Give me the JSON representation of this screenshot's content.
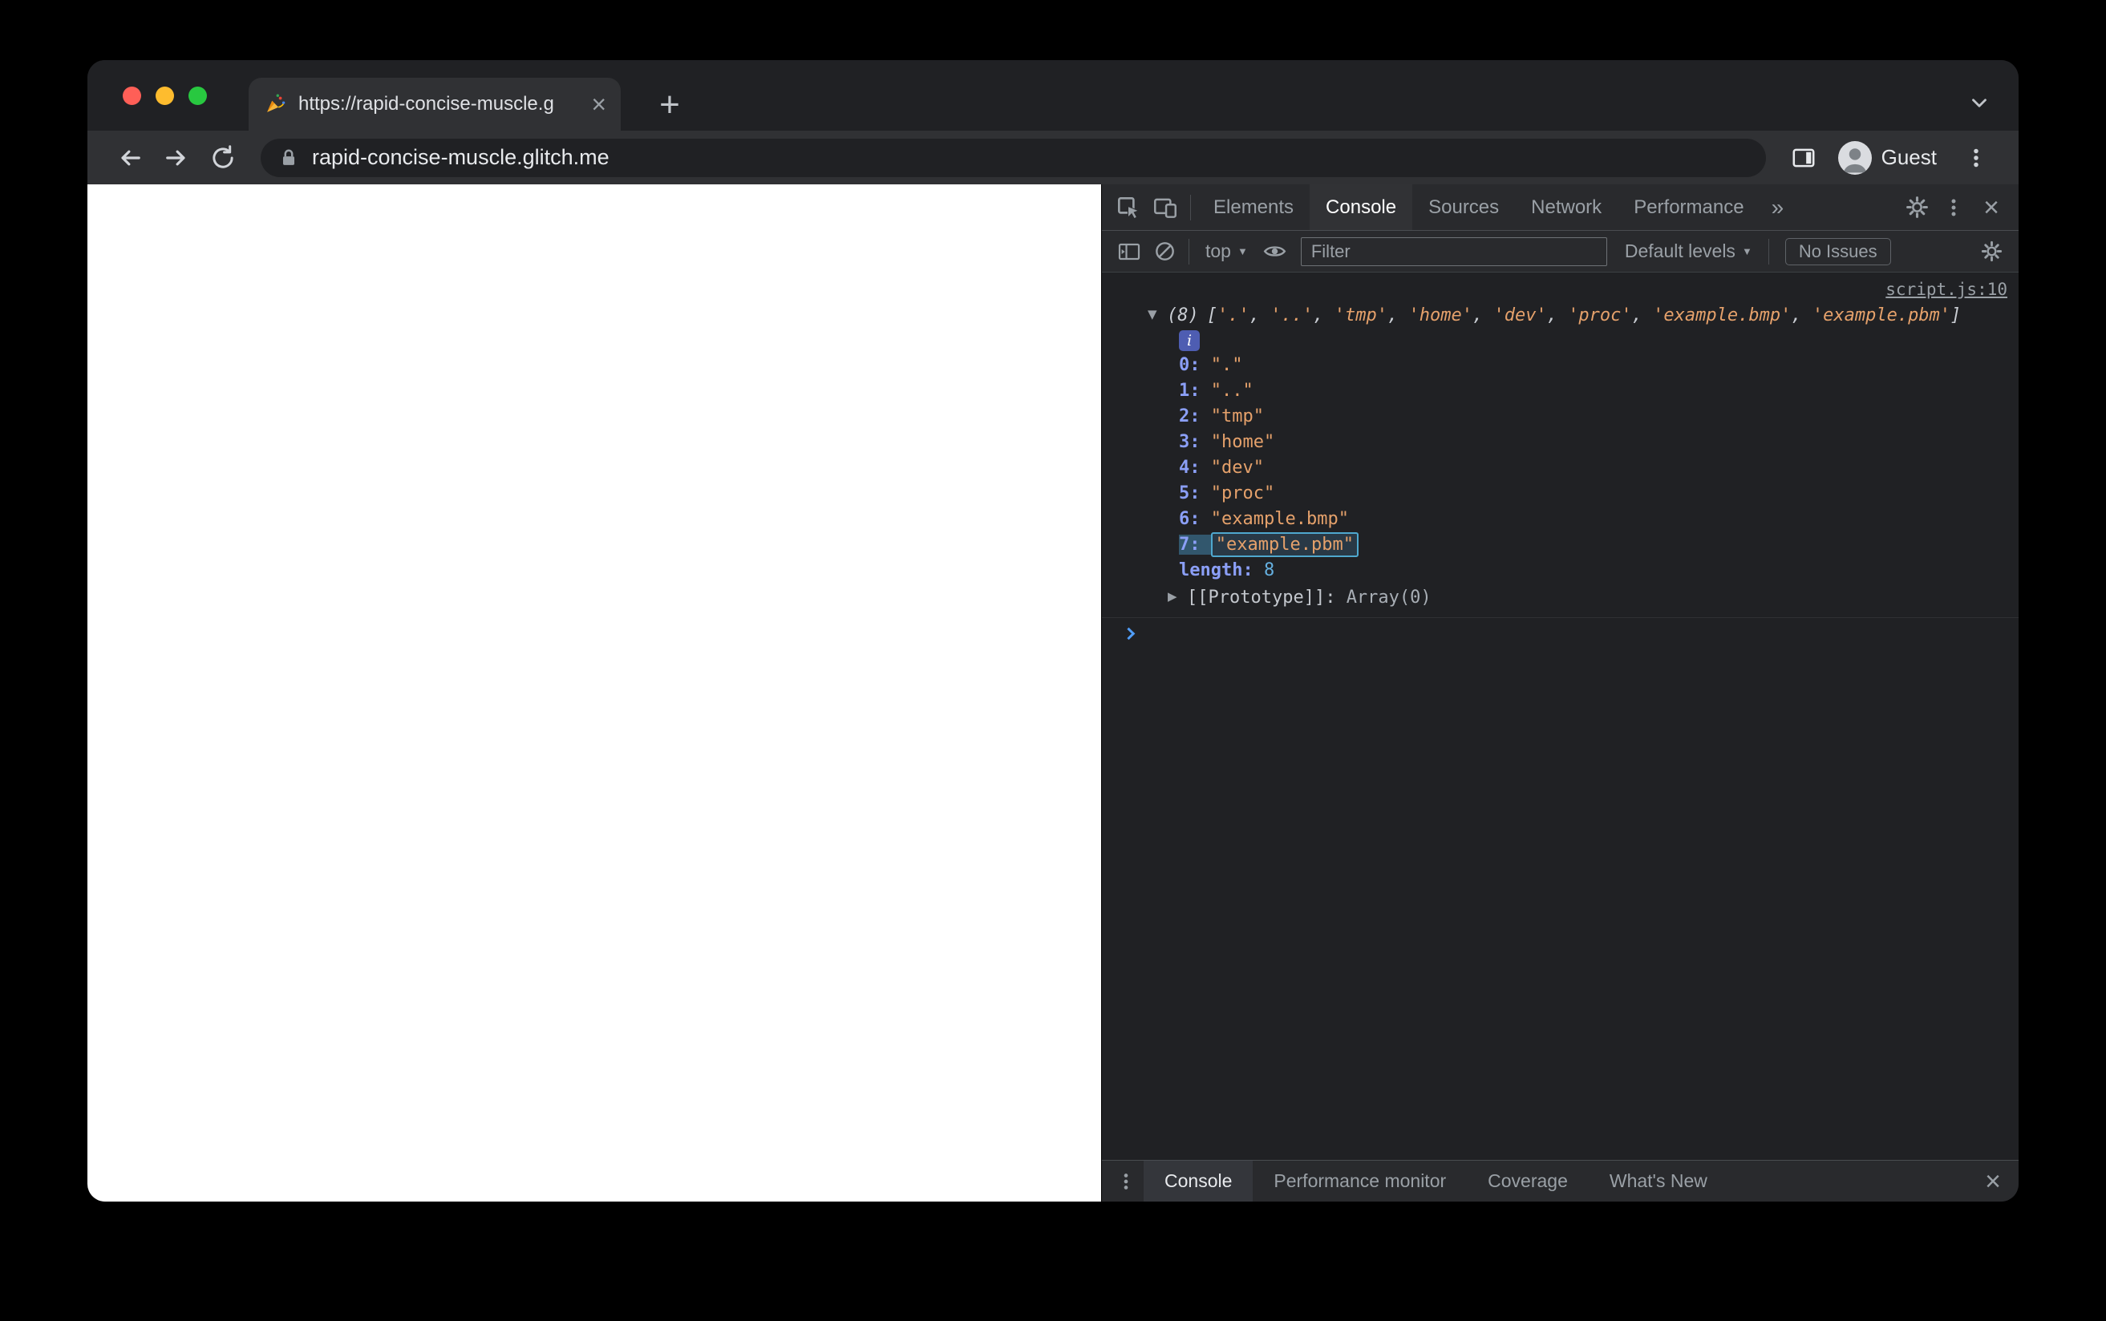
{
  "glyphs": {
    "close": "×",
    "plus": "+",
    "caret": "▼"
  },
  "browser": {
    "tab": {
      "favicon": "party-popper",
      "title": "https://rapid-concise-muscle.g"
    },
    "address": {
      "url": "rapid-concise-muscle.glitch.me"
    },
    "profile": {
      "label": "Guest"
    }
  },
  "devtools": {
    "main_tabs": [
      "Elements",
      "Console",
      "Sources",
      "Network",
      "Performance"
    ],
    "active_main_tab": "Console",
    "more_tabs_symbol": "»",
    "console_toolbar": {
      "context_selector": "top",
      "filter_placeholder": "Filter",
      "levels": "Default levels",
      "issues": "No Issues"
    },
    "console": {
      "source_link": "script.js:10",
      "kv_separator": ": ",
      "item_separator": ", ",
      "preview": {
        "expander": "▼",
        "count": "(8)",
        "open_bracket": "[",
        "close_bracket": "]",
        "items": [
          "'.'",
          "'..'",
          "'tmp'",
          "'home'",
          "'dev'",
          "'proc'",
          "'example.bmp'",
          "'example.pbm'"
        ]
      },
      "info_badge": "i",
      "entries": [
        {
          "index": "0",
          "value": "\".\""
        },
        {
          "index": "1",
          "value": "\"..\""
        },
        {
          "index": "2",
          "value": "\"tmp\""
        },
        {
          "index": "3",
          "value": "\"home\""
        },
        {
          "index": "4",
          "value": "\"dev\""
        },
        {
          "index": "5",
          "value": "\"proc\""
        },
        {
          "index": "6",
          "value": "\"example.bmp\""
        },
        {
          "index": "7",
          "value": "\"example.pbm\"",
          "highlighted": true
        }
      ],
      "length": {
        "key": "length",
        "value": "8"
      },
      "prototype": {
        "expander": "▶",
        "key": "[[Prototype]]",
        "value": "Array(0)"
      }
    },
    "drawer_tabs": [
      "Console",
      "Performance monitor",
      "Coverage",
      "What's New"
    ],
    "active_drawer_tab": "Console"
  },
  "colors": {
    "string_orange": "#e5a16b",
    "index_blue": "#8b9ff7",
    "number_blue": "#65b0e0",
    "highlight_teal": "#4fa8ce",
    "devtools_bg": "#202124",
    "toolbar_bg": "#292a2d"
  }
}
